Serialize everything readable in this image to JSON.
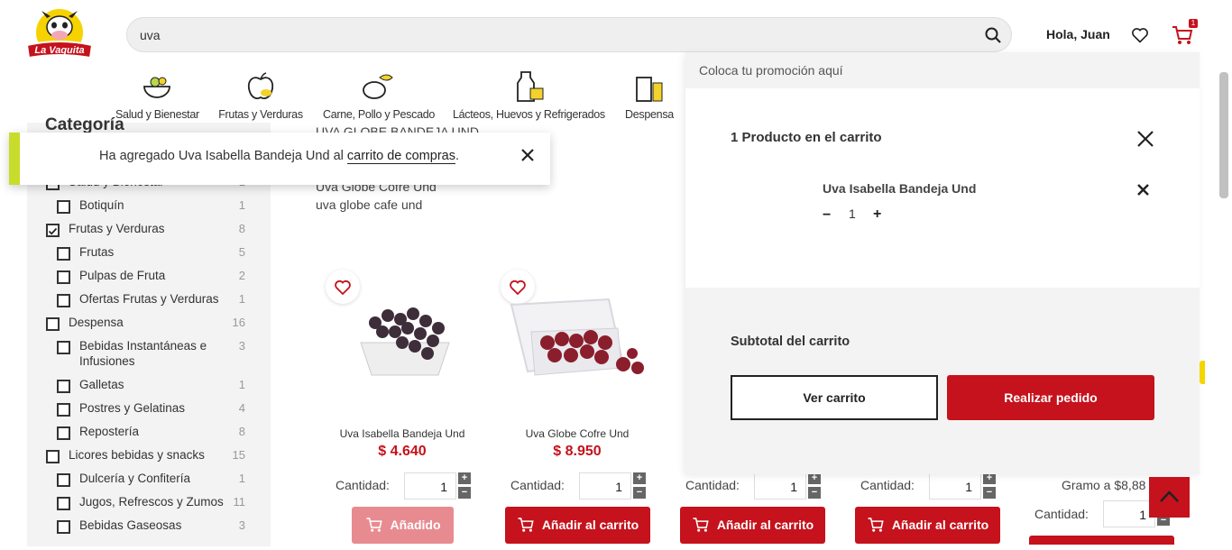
{
  "header": {
    "logo_text": "La Vaquita",
    "search_value": "uva",
    "greeting": "Hola, Juan",
    "cart_badge": "1"
  },
  "categories_nav": [
    {
      "label": "Salud y Bienestar",
      "icon": "salad-bowl-icon"
    },
    {
      "label": "Frutas y Verduras",
      "icon": "apple-icon"
    },
    {
      "label": "Carne, Pollo y Pescado",
      "icon": "meat-fish-icon"
    },
    {
      "label": "Lácteos, Huevos y Refrigerados",
      "icon": "milk-icon"
    },
    {
      "label": "Despensa",
      "icon": "pantry-icon"
    }
  ],
  "sidebar": {
    "title": "Categoría",
    "items": [
      {
        "label": "Salud y Bienestar",
        "count": "1",
        "level": 0,
        "checked": false
      },
      {
        "label": "Botiquín",
        "count": "1",
        "level": 1,
        "checked": false
      },
      {
        "label": "Frutas y Verduras",
        "count": "8",
        "level": 0,
        "checked": true
      },
      {
        "label": "Frutas",
        "count": "5",
        "level": 1,
        "checked": false
      },
      {
        "label": "Pulpas de Fruta",
        "count": "2",
        "level": 1,
        "checked": false
      },
      {
        "label": "Ofertas Frutas y Verduras",
        "count": "1",
        "level": 1,
        "checked": false
      },
      {
        "label": "Despensa",
        "count": "16",
        "level": 0,
        "checked": false
      },
      {
        "label": "Bebidas Instantáneas e",
        "label2": "Infusiones",
        "count": "3",
        "level": 1,
        "checked": false
      },
      {
        "label": "Galletas",
        "count": "1",
        "level": 1,
        "checked": false
      },
      {
        "label": "Postres y Gelatinas",
        "count": "4",
        "level": 1,
        "checked": false
      },
      {
        "label": "Repostería",
        "count": "8",
        "level": 1,
        "checked": false
      },
      {
        "label": "Licores bebidas y snacks",
        "count": "15",
        "level": 0,
        "checked": false
      },
      {
        "label": "Dulcería y Confitería",
        "count": "1",
        "level": 1,
        "checked": false
      },
      {
        "label": "Jugos, Refrescos y Zumos",
        "count": "11",
        "level": 1,
        "checked": false
      },
      {
        "label": "Bebidas Gaseosas",
        "count": "3",
        "level": 1,
        "checked": false
      }
    ]
  },
  "toast": {
    "prefix": "Ha agregado Uva Isabella Bandeja Und al ",
    "link": "carrito de compras",
    "suffix": "."
  },
  "suggestions": [
    "UVA GLOBE BANDEJA UND",
    "Uva Globe Cofre Und",
    "uva globe cafe und"
  ],
  "products": [
    {
      "name": "Uva Isabella Bandeja Und",
      "price": "$ 4.640",
      "qty_label": "Cantidad:",
      "qty": "1",
      "button": "Añadido",
      "added": true
    },
    {
      "name": "Uva Globe Cofre Und",
      "price": "$ 8.950",
      "qty_label": "Cantidad:",
      "qty": "1",
      "button": "Añadir al carrito",
      "added": false
    },
    {
      "name": "",
      "price": "",
      "qty_label": "Cantidad:",
      "qty": "1",
      "button": "Añadir al carrito",
      "added": false
    },
    {
      "name": "",
      "price": "",
      "qty_label": "Cantidad:",
      "qty": "1",
      "button": "Añadir al carrito",
      "added": false
    }
  ],
  "extra_product": {
    "unit_price": "Gramo a $8,88",
    "qty_label": "Cantidad:",
    "qty": "1"
  },
  "cart_panel": {
    "promo": "Coloca tu promoción aquí",
    "count_title": "1 Producto en el carrito",
    "item_name": "Uva Isabella Bandeja Und",
    "item_qty": "1",
    "minus": "−",
    "plus": "+",
    "subtotal_label": "Subtotal del carrito",
    "view_cart": "Ver carrito",
    "checkout": "Realizar pedido"
  },
  "colors": {
    "brand_red": "#c5121c",
    "toast_accent": "#c8dc2b"
  }
}
